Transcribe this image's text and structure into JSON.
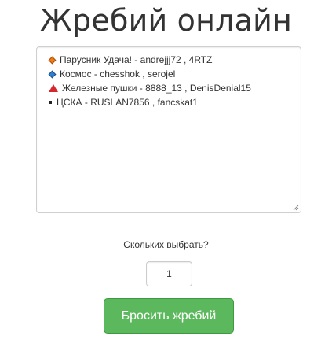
{
  "header": {
    "title": "Жребий онлайн"
  },
  "entries": {
    "items": [
      {
        "icon": "orange-diamond-icon",
        "text": "Парусник Удача! - andrejjj72 , 4RTZ"
      },
      {
        "icon": "blue-diamond-icon",
        "text": "Космос - chesshok , serojel"
      },
      {
        "icon": "red-triangle-icon",
        "text": "Железные пушки - 8888_13 , DenisDenial15"
      },
      {
        "icon": "black-square-icon",
        "text": "ЦСКА - RUSLAN7856 , fancskat1"
      }
    ]
  },
  "count": {
    "label": "Скольких выбрать?",
    "value": "1"
  },
  "action": {
    "button_label": "Бросить жребий",
    "color": "#5cb85c"
  },
  "colors": {
    "orange_diamond": "#f37b16",
    "blue_diamond": "#2f7fd0",
    "red_triangle": "#d6262e",
    "black_square": "#222222"
  }
}
